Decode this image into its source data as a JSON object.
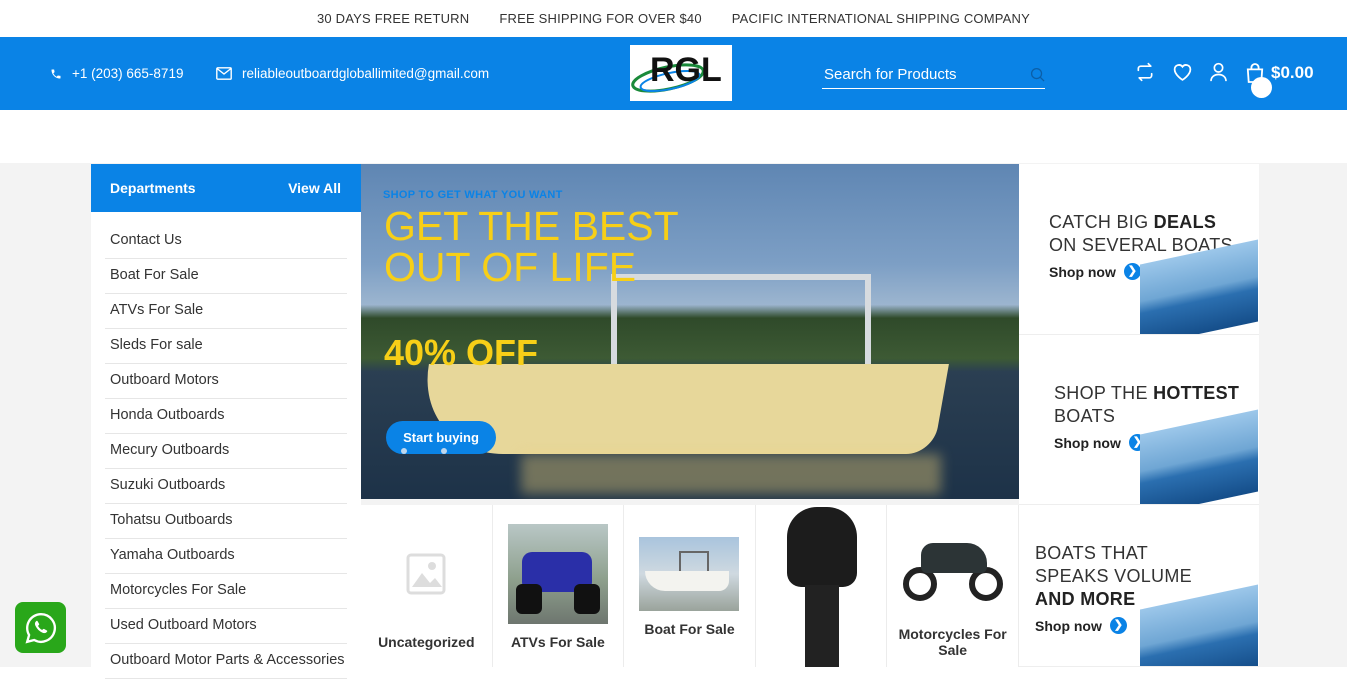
{
  "topbar": {
    "items": [
      "30 DAYS FREE RETURN",
      "FREE SHIPPING FOR OVER $40",
      "PACIFIC INTERNATIONAL SHIPPING COMPANY"
    ]
  },
  "header": {
    "phone": "+1 (203) 665-8719",
    "email": "reliableoutboardgloballimited@gmail.com",
    "logo_text": "RGL",
    "search_placeholder": "Search for Products",
    "cart_total": "$0.00",
    "icons": [
      "phone-icon",
      "mail-icon",
      "search-icon",
      "compare-icon",
      "wishlist-heart-icon",
      "account-user-icon",
      "cart-bag-icon"
    ]
  },
  "departments": {
    "title": "Departments",
    "view_all": "View All",
    "items": [
      "Contact Us",
      "Boat For Sale",
      "ATVs For Sale",
      "Sleds For sale",
      "Outboard Motors",
      "Honda Outboards",
      "Mecury Outboards",
      "Suzuki Outboards",
      "Tohatsu Outboards",
      "Yamaha Outboards",
      "Motorcycles For Sale",
      "Used Outboard Motors",
      "Outboard Motor Parts & Accessories"
    ]
  },
  "hero": {
    "subtitle": "SHOP TO GET WHAT YOU WANT",
    "title": "GET THE BEST OUT OF LIFE",
    "offer": "40% OFF",
    "button": "Start buying",
    "slides": 3,
    "active_slide": 2
  },
  "promos": [
    {
      "title_pre": "CATCH BIG ",
      "title_bold": "DEALS",
      "title_post": " ON SEVERAL BOATS",
      "cta": "Shop now"
    },
    {
      "title_pre": "SHOP THE ",
      "title_bold": "HOTTEST",
      "title_post": " BOATS",
      "cta": "Shop now"
    },
    {
      "title_pre": "BOATS THAT SPEAKS VOLUME ",
      "title_bold": "AND MORE",
      "title_post": "",
      "cta": "Shop now"
    }
  ],
  "categories": [
    {
      "name": "Uncategorized"
    },
    {
      "name": "ATVs For Sale"
    },
    {
      "name": "Boat For Sale"
    },
    {
      "name": ""
    },
    {
      "name": "Motorcycles For Sale"
    }
  ],
  "colors": {
    "brand_blue": "#0a83e6",
    "hero_yellow": "#f7cf17",
    "whatsapp_green": "#29a71a"
  }
}
